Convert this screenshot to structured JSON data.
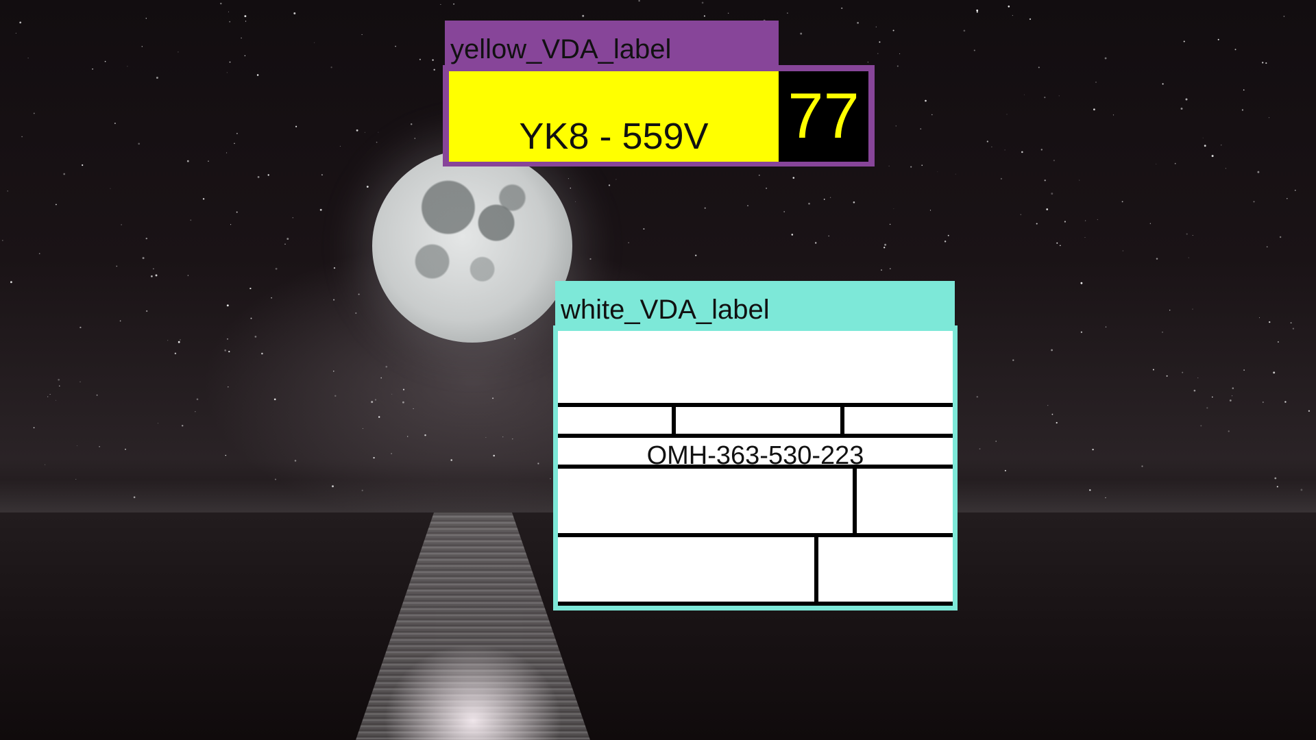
{
  "scene": {
    "description_icon": "night-sea-moon-background"
  },
  "yellow_label": {
    "tag": "yellow_VDA_label",
    "code": "YK8 - 559V",
    "number": "77",
    "colors": {
      "tag": "#874599",
      "plate": "#ffff00",
      "number_bg": "#000000",
      "number_text": "#ffff00"
    }
  },
  "white_label": {
    "tag": "white_VDA_label",
    "code": "OMH-363-530-223",
    "colors": {
      "tag": "#7de8d8",
      "plate": "#ffffff"
    }
  }
}
